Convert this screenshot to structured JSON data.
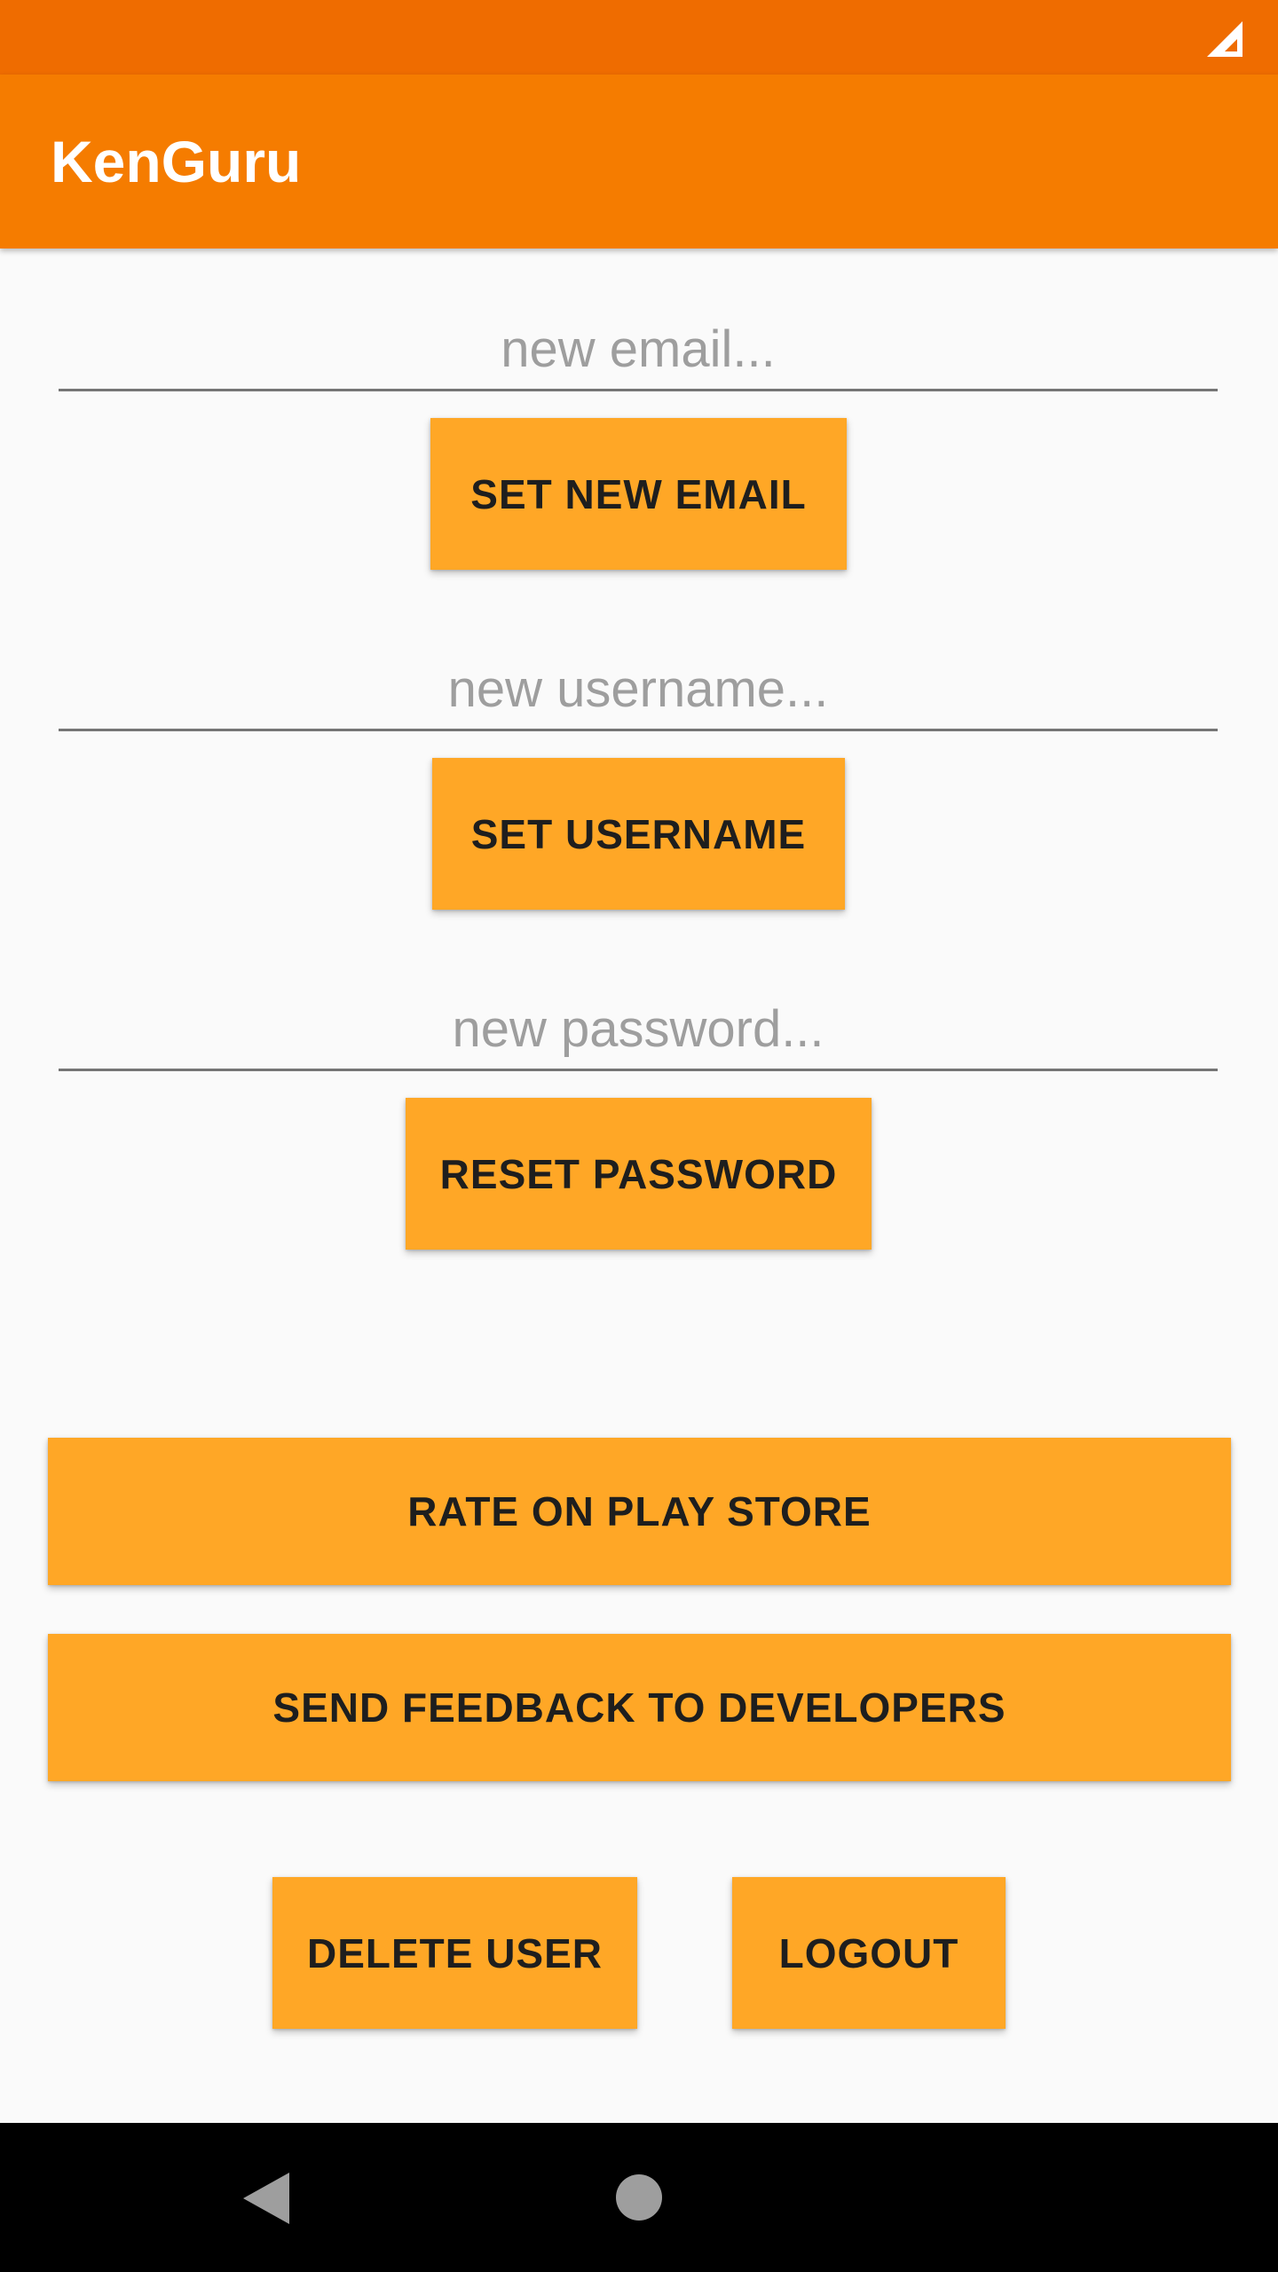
{
  "app": {
    "title": "KenGuru"
  },
  "status_bar": {
    "icons": [
      "signal-icon"
    ]
  },
  "form": {
    "email": {
      "value": "",
      "placeholder": "new email...",
      "button_label": "SET NEW EMAIL"
    },
    "username": {
      "value": "",
      "placeholder": "new username...",
      "button_label": "SET USERNAME"
    },
    "password": {
      "value": "",
      "placeholder": "new password...",
      "button_label": "RESET PASSWORD"
    }
  },
  "actions": {
    "rate_label": "RATE ON PLAY STORE",
    "feedback_label": "SEND FEEDBACK TO DEVELOPERS",
    "delete_user_label": "DELETE USER",
    "logout_label": "LOGOUT"
  },
  "nav_bar": {
    "icons": [
      "back-icon",
      "home-icon"
    ]
  },
  "colors": {
    "status_bar": "#ef6c00",
    "app_bar": "#f57c00",
    "button": "#ffa726",
    "background": "#fafafa"
  }
}
